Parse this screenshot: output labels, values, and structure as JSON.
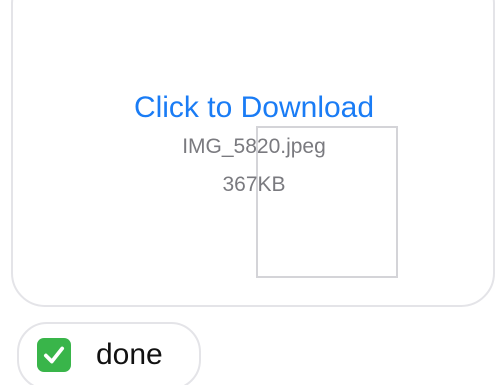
{
  "attachment": {
    "download_label": "Click to Download",
    "file_name": "IMG_5820.jpeg",
    "file_size": "367KB"
  },
  "reply": {
    "icon": "check-mark-button-icon",
    "text": "done"
  },
  "colors": {
    "link": "#1a7cf5",
    "secondary_text": "#7a7a7f",
    "bubble_border": "#e4e4e8",
    "check_green": "#39b54a"
  }
}
